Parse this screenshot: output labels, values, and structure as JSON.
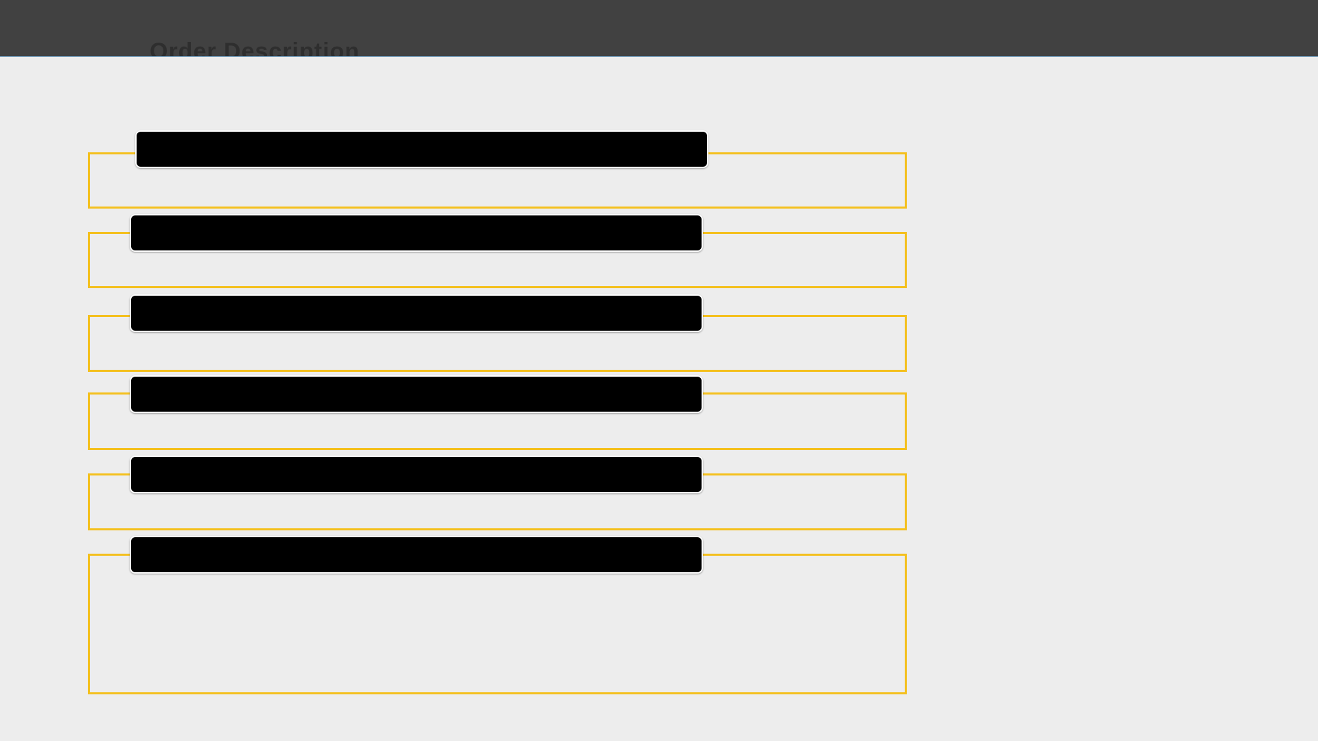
{
  "slide": {
    "title": "Order Description"
  },
  "sections": [
    {
      "label": ""
    },
    {
      "label": ""
    },
    {
      "label": ""
    },
    {
      "label": ""
    },
    {
      "label": ""
    },
    {
      "label": ""
    }
  ],
  "colors": {
    "header_bar": "#414141",
    "background": "#ededed",
    "frame_border": "#f4c01e",
    "label_fill": "#000000"
  }
}
